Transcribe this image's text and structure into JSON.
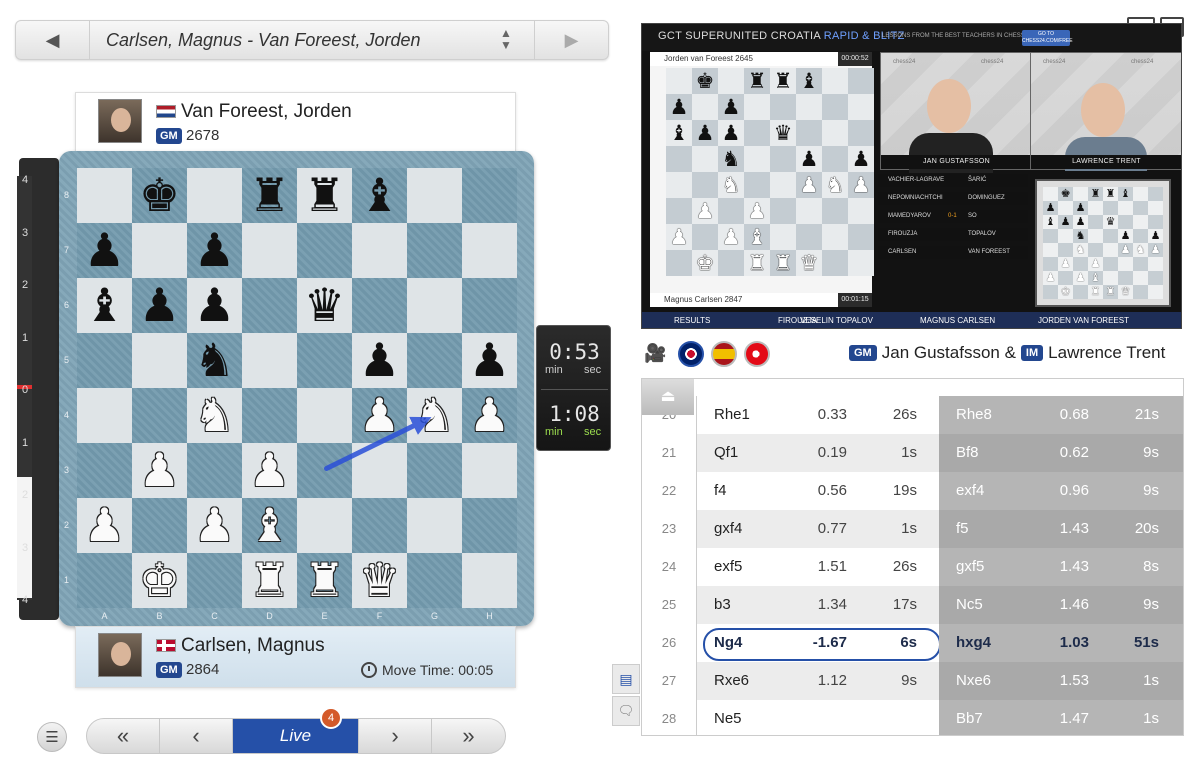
{
  "game_selector": {
    "title": "Carlsen, Magnus - Van Foreest, Jorden",
    "prev_icon": "◀",
    "next_icon": "▶",
    "dropdown_icon": "▲▼"
  },
  "top_player": {
    "name": "Van Foreest, Jorden",
    "title": "GM",
    "rating": "2678",
    "flag": "netherlands"
  },
  "bottom_player": {
    "name": "Carlsen, Magnus",
    "title": "GM",
    "rating": "2864",
    "flag": "norway",
    "move_time_label": "Move Time: 00:05"
  },
  "eval_bar": {
    "ticks": [
      "4",
      "3",
      "2",
      "1",
      "0",
      "1",
      "2",
      "3",
      "4"
    ],
    "white_share": 0.27
  },
  "board": {
    "files": [
      "A",
      "B",
      "C",
      "D",
      "E",
      "F",
      "G",
      "H"
    ],
    "ranks": [
      "8",
      "7",
      "6",
      "5",
      "4",
      "3",
      "2",
      "1"
    ],
    "rows": [
      [
        "",
        "k",
        "",
        "r",
        "r",
        "b",
        "",
        ""
      ],
      [
        "p",
        "",
        "p",
        "",
        "",
        "",
        "",
        ""
      ],
      [
        "b",
        "p",
        "p",
        "",
        "q",
        "",
        "",
        ""
      ],
      [
        "",
        "",
        "n",
        "",
        "",
        "p",
        "",
        "p"
      ],
      [
        "",
        "",
        "N",
        "",
        "",
        "P",
        "N",
        "P"
      ],
      [
        "",
        "P",
        "",
        "P",
        "",
        "",
        "",
        ""
      ],
      [
        "P",
        "",
        "P",
        "B",
        "",
        "",
        "",
        ""
      ],
      [
        "",
        "K",
        "",
        "R",
        "R",
        "Q",
        "",
        ""
      ]
    ],
    "last_move_arrow": {
      "from": "e3",
      "to": "g4",
      "color": "#2a4fd8"
    }
  },
  "clocks": {
    "top": {
      "time": "0:53",
      "min_label": "min",
      "sec_label": "sec"
    },
    "bottom": {
      "time": "1:08",
      "min_label": "min",
      "sec_label": "sec"
    }
  },
  "controls": {
    "menu_icon": "☰",
    "first": "«",
    "prev": "‹",
    "live_label": "Live",
    "live_badge": "4",
    "next": "›",
    "last": "»"
  },
  "video": {
    "title_plain": "GCT SUPERUNITED CROATIA ",
    "title_highlight": "RAPID & BLITZ",
    "promo": "LESSONS FROM THE BEST TEACHERS IN CHESS.",
    "go_label": "GO TO CHESS24.COM/FREE",
    "board_top_player": "Jorden van Foreest 2645",
    "board_top_clock": "00:00:52",
    "board_bottom_player": "Magnus Carlsen 2847",
    "board_bottom_clock": "00:01:15",
    "cam1_name": "JAN GUSTAFSSON",
    "cam2_name": "LAWRENCE TRENT",
    "watermark": "chess24",
    "results": [
      {
        "white": "VACHIER-LAGRAVE",
        "result": "",
        "black": "ŠARIĆ"
      },
      {
        "white": "NEPOMNIACHTCHI",
        "result": "",
        "black": "DOMINGUEZ"
      },
      {
        "white": "MAMEDYAROV",
        "result": "0-1",
        "black": "SO"
      },
      {
        "white": "FIROUZJA",
        "result": "",
        "black": "TOPALOV"
      },
      {
        "white": "CARLSEN",
        "result": "",
        "black": "VAN FOREEST"
      }
    ],
    "ticker": {
      "results_label": "RESULTS",
      "p1": "FIROUZJA",
      "p2": "VESELIN TOPALOV",
      "p3": "MAGNUS CARLSEN",
      "p4": "JORDEN VAN FOREEST"
    }
  },
  "broadcast": {
    "commentator1_title": "GM",
    "commentator1": "Jan Gustafsson &",
    "commentator2_title": "IM",
    "commentator2": "Lawrence Trent"
  },
  "moves": [
    {
      "num": "20",
      "white": "Rhe1",
      "w_eval": "0.33",
      "w_time": "26s",
      "black": "Rhe8",
      "b_eval": "0.68",
      "b_time": "21s"
    },
    {
      "num": "21",
      "white": "Qf1",
      "w_eval": "0.19",
      "w_time": "1s",
      "black": "Bf8",
      "b_eval": "0.62",
      "b_time": "9s"
    },
    {
      "num": "22",
      "white": "f4",
      "w_eval": "0.56",
      "w_time": "19s",
      "black": "exf4",
      "b_eval": "0.96",
      "b_time": "9s"
    },
    {
      "num": "23",
      "white": "gxf4",
      "w_eval": "0.77",
      "w_time": "1s",
      "black": "f5",
      "b_eval": "1.43",
      "b_time": "20s"
    },
    {
      "num": "24",
      "white": "exf5",
      "w_eval": "1.51",
      "w_time": "26s",
      "black": "gxf5",
      "b_eval": "1.43",
      "b_time": "8s"
    },
    {
      "num": "25",
      "white": "b3",
      "w_eval": "1.34",
      "w_time": "17s",
      "black": "Nc5",
      "b_eval": "1.46",
      "b_time": "9s"
    },
    {
      "num": "26",
      "white": "Ng4",
      "w_eval": "-1.67",
      "w_time": "6s",
      "black": "hxg4",
      "b_eval": "1.03",
      "b_time": "51s"
    },
    {
      "num": "27",
      "white": "Rxe6",
      "w_eval": "1.12",
      "w_time": "9s",
      "black": "Nxe6",
      "b_eval": "1.53",
      "b_time": "1s"
    },
    {
      "num": "28",
      "white": "Ne5",
      "w_eval": "",
      "w_time": "",
      "black": "Bb7",
      "b_eval": "1.47",
      "b_time": "1s"
    }
  ],
  "current_move_index": 6,
  "colors": {
    "accent": "#2550a8",
    "live_badge": "#d45a2a",
    "arrow": "#2a4fd8"
  }
}
